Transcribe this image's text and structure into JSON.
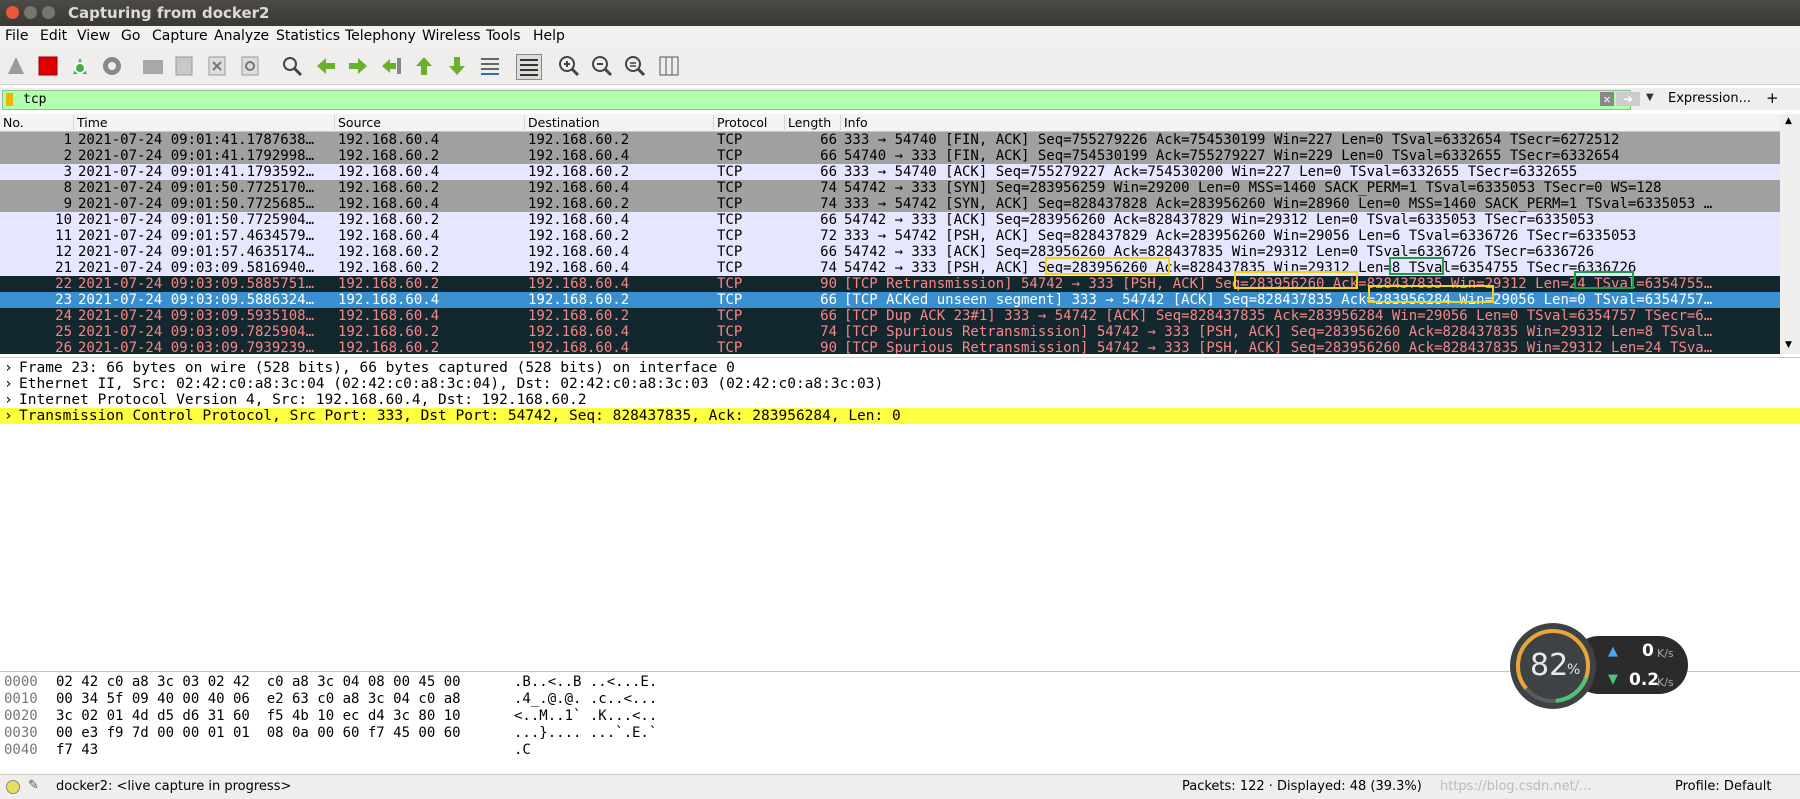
{
  "window": {
    "title": "Capturing from docker2"
  },
  "menu": [
    "File",
    "Edit",
    "View",
    "Go",
    "Capture",
    "Analyze",
    "Statistics",
    "Telephony",
    "Wireless",
    "Tools",
    "Help"
  ],
  "filter": {
    "value": "tcp",
    "expression_label": "Expression...",
    "plus": "+"
  },
  "columns": {
    "no": "No.",
    "time": "Time",
    "source": "Source",
    "destination": "Destination",
    "protocol": "Protocol",
    "length": "Length",
    "info": "Info"
  },
  "packets": [
    {
      "no": "1",
      "time": "2021-07-24 09:01:41.1787638…",
      "src": "192.168.60.4",
      "dst": "192.168.60.2",
      "proto": "TCP",
      "len": "66",
      "info": "333 → 54740 [FIN, ACK] Seq=755279226 Ack=754530199 Win=227 Len=0 TSval=6332654 TSecr=6272512",
      "style": "gray"
    },
    {
      "no": "2",
      "time": "2021-07-24 09:01:41.1792998…",
      "src": "192.168.60.2",
      "dst": "192.168.60.4",
      "proto": "TCP",
      "len": "66",
      "info": "54740 → 333 [FIN, ACK] Seq=754530199 Ack=755279227 Win=229 Len=0 TSval=6332655 TSecr=6332654",
      "style": "gray"
    },
    {
      "no": "3",
      "time": "2021-07-24 09:01:41.1793592…",
      "src": "192.168.60.4",
      "dst": "192.168.60.2",
      "proto": "TCP",
      "len": "66",
      "info": "333 → 54740 [ACK] Seq=755279227 Ack=754530200 Win=227 Len=0 TSval=6332655 TSecr=6332655",
      "style": "lav"
    },
    {
      "no": "8",
      "time": "2021-07-24 09:01:50.7725170…",
      "src": "192.168.60.2",
      "dst": "192.168.60.4",
      "proto": "TCP",
      "len": "74",
      "info": "54742 → 333 [SYN] Seq=283956259 Win=29200 Len=0 MSS=1460 SACK_PERM=1 TSval=6335053 TSecr=0 WS=128",
      "style": "gray"
    },
    {
      "no": "9",
      "time": "2021-07-24 09:01:50.7725685…",
      "src": "192.168.60.4",
      "dst": "192.168.60.2",
      "proto": "TCP",
      "len": "74",
      "info": "333 → 54742 [SYN, ACK] Seq=828437828 Ack=283956260 Win=28960 Len=0 MSS=1460 SACK_PERM=1 TSval=6335053 …",
      "style": "gray"
    },
    {
      "no": "10",
      "time": "2021-07-24 09:01:50.7725904…",
      "src": "192.168.60.2",
      "dst": "192.168.60.4",
      "proto": "TCP",
      "len": "66",
      "info": "54742 → 333 [ACK] Seq=283956260 Ack=828437829 Win=29312 Len=0 TSval=6335053 TSecr=6335053",
      "style": "lav"
    },
    {
      "no": "11",
      "time": "2021-07-24 09:01:57.4634579…",
      "src": "192.168.60.4",
      "dst": "192.168.60.2",
      "proto": "TCP",
      "len": "72",
      "info": "333 → 54742 [PSH, ACK] Seq=828437829 Ack=283956260 Win=29056 Len=6 TSval=6336726 TSecr=6335053",
      "style": "lav"
    },
    {
      "no": "12",
      "time": "2021-07-24 09:01:57.4635174…",
      "src": "192.168.60.2",
      "dst": "192.168.60.4",
      "proto": "TCP",
      "len": "66",
      "info": "54742 → 333 [ACK] Seq=283956260 Ack=828437835 Win=29312 Len=0 TSval=6336726 TSecr=6336726",
      "style": "lav"
    },
    {
      "no": "21",
      "time": "2021-07-24 09:03:09.5816940…",
      "src": "192.168.60.2",
      "dst": "192.168.60.4",
      "proto": "TCP",
      "len": "74",
      "info": "54742 → 333 [PSH, ACK] Seq=283956260 Ack=828437835 Win=29312 Len=8 TSval=6354755 TSecr=6336726",
      "style": "lav"
    },
    {
      "no": "22",
      "time": "2021-07-24 09:03:09.5885751…",
      "src": "192.168.60.2",
      "dst": "192.168.60.4",
      "proto": "TCP",
      "len": "90",
      "info": "[TCP Retransmission] 54742 → 333 [PSH, ACK] Seq=283956260 Ack=828437835 Win=29312 Len=24 TSval=6354755…",
      "style": "bad"
    },
    {
      "no": "23",
      "time": "2021-07-24 09:03:09.5886324…",
      "src": "192.168.60.4",
      "dst": "192.168.60.2",
      "proto": "TCP",
      "len": "66",
      "info": "[TCP ACKed unseen segment] 333 → 54742 [ACK] Seq=828437835 Ack=283956284 Win=29056 Len=0 TSval=6354757…",
      "style": "sel"
    },
    {
      "no": "24",
      "time": "2021-07-24 09:03:09.5935108…",
      "src": "192.168.60.4",
      "dst": "192.168.60.2",
      "proto": "TCP",
      "len": "66",
      "info": "[TCP Dup ACK 23#1] 333 → 54742 [ACK] Seq=828437835 Ack=283956284 Win=29056 Len=0 TSval=6354757 TSecr=6…",
      "style": "bad"
    },
    {
      "no": "25",
      "time": "2021-07-24 09:03:09.7825904…",
      "src": "192.168.60.2",
      "dst": "192.168.60.4",
      "proto": "TCP",
      "len": "74",
      "info": "[TCP Spurious Retransmission] 54742 → 333 [PSH, ACK] Seq=283956260 Ack=828437835 Win=29312 Len=8 TSval…",
      "style": "bad"
    },
    {
      "no": "26",
      "time": "2021-07-24 09:03:09.7939239…",
      "src": "192.168.60.2",
      "dst": "192.168.60.4",
      "proto": "TCP",
      "len": "90",
      "info": "[TCP Spurious Retransmission] 54742 → 333 [PSH, ACK] Seq=283956260 Ack=828437835 Win=29312 Len=24 TSva…",
      "style": "bad"
    }
  ],
  "details": [
    "Frame 23: 66 bytes on wire (528 bits), 66 bytes captured (528 bits) on interface 0",
    "Ethernet II, Src: 02:42:c0:a8:3c:04 (02:42:c0:a8:3c:04), Dst: 02:42:c0:a8:3c:03 (02:42:c0:a8:3c:03)",
    "Internet Protocol Version 4, Src: 192.168.60.4, Dst: 192.168.60.2",
    "Transmission Control Protocol, Src Port: 333, Dst Port: 54742, Seq: 828437835, Ack: 283956284, Len: 0"
  ],
  "hex": [
    {
      "off": "0000",
      "bytes": "02 42 c0 a8 3c 03 02 42  c0 a8 3c 04 08 00 45 00",
      "ascii": ".B..<..B ..<...E."
    },
    {
      "off": "0010",
      "bytes": "00 34 5f 09 40 00 40 06  e2 63 c0 a8 3c 04 c0 a8",
      "ascii": ".4_.@.@. .c..<..."
    },
    {
      "off": "0020",
      "bytes": "3c 02 01 4d d5 d6 31 60  f5 4b 10 ec d4 3c 80 10",
      "ascii": "<..M..1` .K...<.."
    },
    {
      "off": "0030",
      "bytes": "00 e3 f9 7d 00 00 01 01  08 0a 00 60 f7 45 00 60",
      "ascii": "...}.... ...`.E.`"
    },
    {
      "off": "0040",
      "bytes": "f7 43",
      "ascii": ".C"
    }
  ],
  "status": {
    "capture": "docker2: <live capture in progress>",
    "packets": "Packets: 122 · Displayed: 48 (39.3%)",
    "profile": "Profile: Default",
    "watermark": "https://blog.csdn.net/..."
  },
  "speed": {
    "percent": "82",
    "pct_sign": "%",
    "up": "0",
    "down": "0.2",
    "unit": "K/s"
  },
  "colors": {
    "gray": "#a0a0a0",
    "lav": "#e7e6ff",
    "bad": "#12272e",
    "bad_text": "#f78787",
    "sel": "#3a8fd0",
    "filter_ok": "#afffaf",
    "detail_hl": "#ffff40"
  }
}
